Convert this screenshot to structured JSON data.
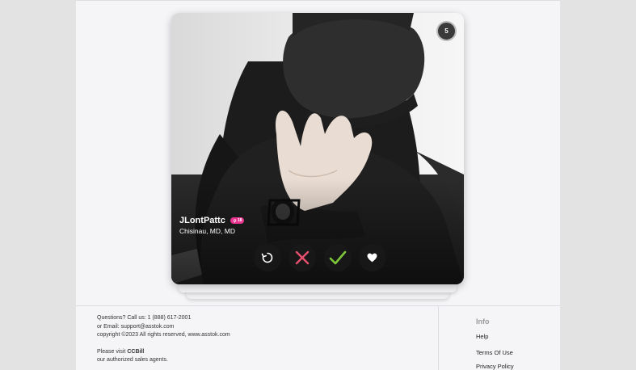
{
  "profile": {
    "name": "JLontPattc",
    "badge": "18",
    "location": "Chisinau, MD, MD",
    "timer": "5"
  },
  "actions": {
    "rewind_icon": "rewind-icon",
    "dislike_icon": "close-icon",
    "like_icon": "check-icon",
    "superlike_icon": "heart-icon"
  },
  "colors": {
    "dislike": "#e8506e",
    "like": "#7ec63a",
    "badge": "#e8348e"
  },
  "footer": {
    "questions": "Questions? Call us: 1 (888) 617-2001",
    "email": "or Email: support@asstok.com",
    "copyright": "copyright ©2023 All rights reserved, www.asstok.com",
    "visit_prefix": "Please visit",
    "visit_brand": "CCBill",
    "agents": "our authorized sales agents.",
    "info_title": "Info",
    "links": [
      "Help",
      "Terms Of Use",
      "Privacy Policy"
    ]
  }
}
